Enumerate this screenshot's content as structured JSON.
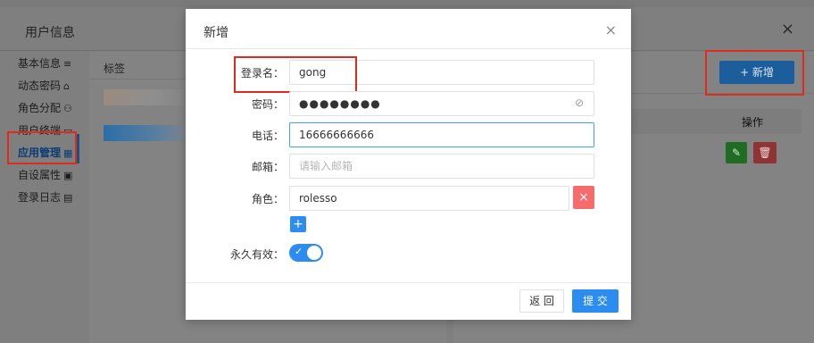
{
  "background": {
    "title": "用户信息",
    "close_icon": "×",
    "sidebar": [
      {
        "label": "基本信息",
        "icon": "≡"
      },
      {
        "label": "动态密码",
        "icon": "⌂"
      },
      {
        "label": "角色分配",
        "icon": "⚇"
      },
      {
        "label": "用户终端",
        "icon": "▭"
      },
      {
        "label": "应用管理",
        "icon": "▦"
      },
      {
        "label": "自设属性",
        "icon": "▣"
      },
      {
        "label": "登录日志",
        "icon": "▤"
      }
    ],
    "card_header": "标签",
    "add_button": "+ 新增",
    "table_header_ops": "操作",
    "edit_icon": "✎",
    "delete_icon": "🗑"
  },
  "modal": {
    "title": "新增",
    "close_icon": "×",
    "fields": {
      "username": {
        "label": "登录名：",
        "value": "gong"
      },
      "password": {
        "label": "密码：",
        "value": "●●●●●●●●",
        "eye_icon": "⊘"
      },
      "phone": {
        "label": "电话：",
        "value": "16666666666"
      },
      "email": {
        "label": "邮箱：",
        "placeholder": "请输入邮箱"
      },
      "role": {
        "label": "角色：",
        "value": "rolesso",
        "delete_icon": "×",
        "add_icon": "+"
      },
      "permanent": {
        "label": "永久有效：",
        "check_icon": "✓",
        "on": true
      }
    },
    "buttons": {
      "back": "返 回",
      "submit": "提 交"
    }
  },
  "colors": {
    "primary": "#2d8cf0",
    "danger": "#f56c6c",
    "highlight": "#e02a1e"
  }
}
